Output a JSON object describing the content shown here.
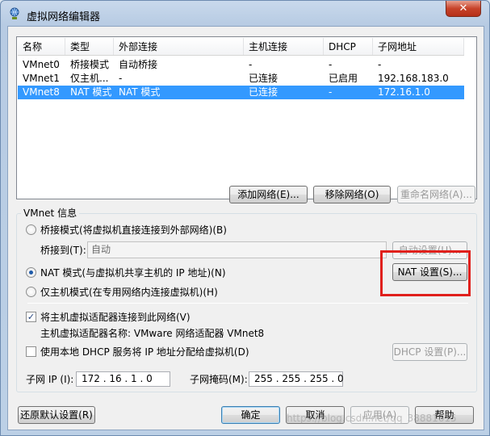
{
  "window": {
    "title": "虚拟网络编辑器",
    "close_glyph": "✕"
  },
  "table": {
    "headers": [
      "名称",
      "类型",
      "外部连接",
      "主机连接",
      "DHCP",
      "子网地址"
    ],
    "rows": [
      [
        "VMnet0",
        "桥接模式",
        "自动桥接",
        "-",
        "-",
        "-"
      ],
      [
        "VMnet1",
        "仅主机...",
        "-",
        "已连接",
        "已启用",
        "192.168.183.0"
      ],
      [
        "VMnet8",
        "NAT 模式",
        "NAT 模式",
        "已连接",
        "-",
        "172.16.1.0"
      ]
    ],
    "selected_row": 2
  },
  "list_buttons": {
    "add": "添加网络(E)...",
    "remove": "移除网络(O)",
    "rename": "重命名网络(A)..."
  },
  "vmnet_info": {
    "title": "VMnet 信息",
    "bridged_option": "桥接模式(将虚拟机直接连接到外部网络)(B)",
    "bridge_to_label": "桥接到(T):",
    "bridge_to_value": "自动",
    "auto_settings": "自动设置(U)...",
    "nat_option": "NAT 模式(与虚拟机共享主机的 IP 地址)(N)",
    "nat_settings": "NAT 设置(S)...",
    "host_only_option": "仅主机模式(在专用网络内连接虚拟机)(H)",
    "connect_adapter": "将主机虚拟适配器连接到此网络(V)",
    "adapter_name": "主机虚拟适配器名称: VMware 网络适配器 VMnet8",
    "use_dhcp": "使用本地 DHCP 服务将 IP 地址分配给虚拟机(D)",
    "dhcp_settings": "DHCP 设置(P)...",
    "subnet_ip_label": "子网 IP (I):",
    "subnet_ip": "172 . 16 . 1 . 0",
    "subnet_mask_label": "子网掩码(M):",
    "subnet_mask": "255 . 255 . 255 . 0",
    "mode": "nat",
    "connect_adapter_checked": true,
    "use_dhcp_checked": false
  },
  "footer": {
    "restore": "还原默认设置(R)",
    "ok": "确定",
    "cancel": "取消",
    "apply": "应用(A)",
    "help": "帮助"
  },
  "watermark": "https://blog.csdn.net/qq_38881615",
  "colors": {
    "selection": "#3399ff",
    "highlight": "#e0201c",
    "title_bg": "#b7cbe3"
  }
}
